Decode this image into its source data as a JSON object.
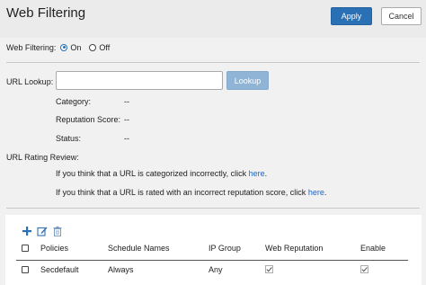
{
  "header": {
    "title": "Web Filtering",
    "apply_label": "Apply",
    "cancel_label": "Cancel"
  },
  "filtering": {
    "label": "Web Filtering:",
    "on_label": "On",
    "off_label": "Off",
    "selected": "On"
  },
  "lookup": {
    "label": "URL Lookup:",
    "input_value": "",
    "button_label": "Lookup",
    "category_label": "Category:",
    "category_value": "--",
    "reputation_label": "Reputation Score:",
    "reputation_value": "--",
    "status_label": "Status:",
    "status_value": "--"
  },
  "review": {
    "label": "URL Rating Review:",
    "line1_text": "If you think that a URL is categorized incorrectly, click",
    "line1_link": "here",
    "line2_text": "If you think that a URL is rated with an incorrect reputation score, click",
    "line2_link": "here",
    "line_end": "."
  },
  "toolbar": {
    "icons": [
      "plus-icon",
      "edit-icon",
      "delete-icon"
    ]
  },
  "table": {
    "columns": [
      "Policies",
      "Schedule Names",
      "IP Group",
      "Web Reputation",
      "Enable"
    ],
    "rows": [
      {
        "policy": "Secdefault",
        "schedule": "Always",
        "ip_group": "Any",
        "web_reputation": true,
        "enable": true
      }
    ]
  },
  "colors": {
    "accent": "#2a70b4",
    "link": "#1a66c9",
    "header_bg": "#ebebeb",
    "page_bg": "#f1f1f1"
  }
}
